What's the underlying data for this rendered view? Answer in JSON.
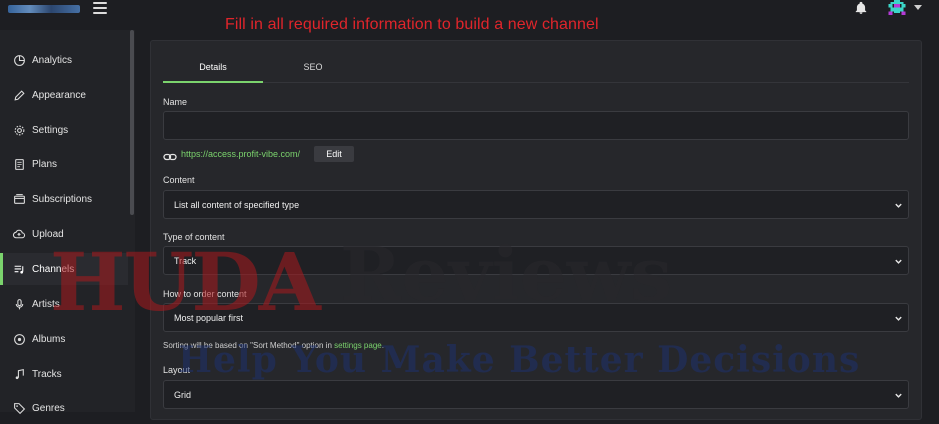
{
  "topbar": {
    "banner": "Fill in all required information to build a new channel",
    "menu_icon": "hamburger-icon",
    "notification_icon": "bell-icon",
    "avatar_icon": "pixel-avatar-icon"
  },
  "sidebar": {
    "items": [
      {
        "label": "Analytics",
        "icon": "pie-chart-icon"
      },
      {
        "label": "Appearance",
        "icon": "brush-icon"
      },
      {
        "label": "Settings",
        "icon": "gear-icon"
      },
      {
        "label": "Plans",
        "icon": "document-icon"
      },
      {
        "label": "Subscriptions",
        "icon": "wallet-icon"
      },
      {
        "label": "Upload",
        "icon": "cloud-upload-icon"
      },
      {
        "label": "Channels",
        "icon": "playlist-icon",
        "active": true
      },
      {
        "label": "Artists",
        "icon": "microphone-icon"
      },
      {
        "label": "Albums",
        "icon": "album-icon"
      },
      {
        "label": "Tracks",
        "icon": "music-note-icon"
      },
      {
        "label": "Genres",
        "icon": "tag-icon"
      }
    ]
  },
  "tabs": [
    {
      "label": "Details",
      "active": true
    },
    {
      "label": "SEO",
      "active": false
    }
  ],
  "form": {
    "name_label": "Name",
    "name_value": "",
    "url": "https://access.profit-vibe.com/",
    "edit_label": "Edit",
    "content_label": "Content",
    "content_value": "List all content of specified type",
    "type_label": "Type of content",
    "type_value": "Track",
    "order_label": "How to order content",
    "order_value": "Most popular first",
    "help_prefix": "Sorting will be based on \"Sort Method\" option in ",
    "help_link": "settings page",
    "help_suffix": ".",
    "layout_label": "Layout",
    "layout_value": "Grid"
  },
  "watermark": {
    "brand_a": "HUDA",
    "brand_b": "Reviews",
    "tagline": "Help You Make Better Decisions"
  },
  "colors": {
    "accent": "#7bd36d",
    "banner": "#e0252b",
    "background": "#1d1e22",
    "panel": "#26272b"
  }
}
